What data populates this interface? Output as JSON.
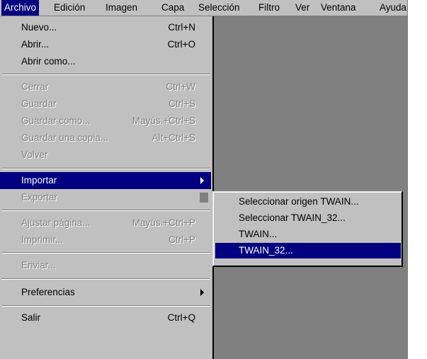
{
  "menubar": {
    "items": [
      {
        "label": "Archivo"
      },
      {
        "label": "Edición"
      },
      {
        "label": "Imagen"
      },
      {
        "label": "Capa"
      },
      {
        "label": "Selección"
      },
      {
        "label": "Filtro"
      },
      {
        "label": "Ver"
      },
      {
        "label": "Ventana"
      },
      {
        "label": "Ayuda"
      }
    ]
  },
  "file_menu": {
    "items": [
      {
        "label": "Nuevo...",
        "shortcut": "Ctrl+N",
        "state": "enabled"
      },
      {
        "label": "Abrir...",
        "shortcut": "Ctrl+O",
        "state": "enabled"
      },
      {
        "label": "Abrir como...",
        "shortcut": "",
        "state": "enabled"
      },
      {
        "label": "Cerrar",
        "shortcut": "Ctrl+W",
        "state": "disabled"
      },
      {
        "label": "Guardar",
        "shortcut": "Ctrl+S",
        "state": "disabled"
      },
      {
        "label": "Guardar como...",
        "shortcut": "Mayús.+Ctrl+S",
        "state": "disabled"
      },
      {
        "label": "Guardar una copia...",
        "shortcut": "Alt+Ctrl+S",
        "state": "disabled"
      },
      {
        "label": "Volver",
        "shortcut": "",
        "state": "disabled"
      },
      {
        "label": "Importar",
        "shortcut": "",
        "state": "selected",
        "submenu": true
      },
      {
        "label": "Exportar",
        "shortcut": "",
        "state": "disabled",
        "submenu": true
      },
      {
        "label": "Ajustar página...",
        "shortcut": "Mayús.+Ctrl+P",
        "state": "disabled"
      },
      {
        "label": "Imprimir...",
        "shortcut": "Ctrl+P",
        "state": "disabled"
      },
      {
        "label": "Enviar...",
        "shortcut": "",
        "state": "disabled"
      },
      {
        "label": "Preferencias",
        "shortcut": "",
        "state": "enabled",
        "submenu": true
      },
      {
        "label": "Salir",
        "shortcut": "Ctrl+Q",
        "state": "enabled"
      }
    ]
  },
  "import_submenu": {
    "items": [
      {
        "label": "Seleccionar origen TWAIN...",
        "state": "enabled"
      },
      {
        "label": "Seleccionar TWAIN_32...",
        "state": "enabled"
      },
      {
        "label": "TWAIN...",
        "state": "enabled"
      },
      {
        "label": "TWAIN_32...",
        "state": "selected"
      }
    ]
  },
  "colors": {
    "menu_bg": "#c0c0c0",
    "highlight": "#000080",
    "workspace": "#808080",
    "disabled_text": "#808080"
  }
}
